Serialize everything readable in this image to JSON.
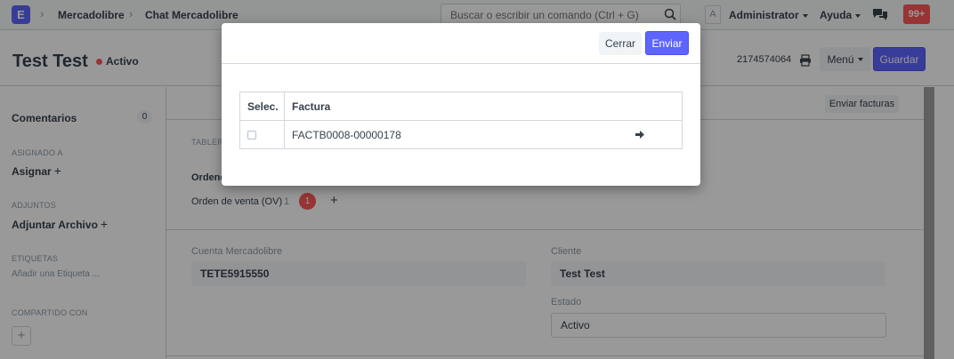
{
  "navbar": {
    "app_initial": "E",
    "breadcrumbs": [
      "Mercadolibre",
      "Chat Mercadolibre"
    ],
    "search_placeholder": "Buscar o escribir un comando (Ctrl + G)",
    "user_initial": "A",
    "user_menu": "Administrator",
    "help_menu": "Ayuda",
    "notification_count": "99+",
    "accent_color": "#5e64ff",
    "badge_color": "#ff5858"
  },
  "page_head": {
    "title": "Test Test",
    "status": "Activo",
    "doc_id": "2174574064",
    "menu_label": "Menú",
    "save_label": "Guardar"
  },
  "sidebar": {
    "comments_label": "Comentarios",
    "comments_count": "0",
    "assigned_heading": "ASIGNADO A",
    "assign_action": "Asignar",
    "attachments_heading": "ADJUNTOS",
    "attach_action": "Adjuntar Archivo",
    "tags_heading": "ETIQUETAS",
    "add_tag": "Añadir una Etiqueta ...",
    "shared_heading": "COMPARTIDO CON",
    "plus": "+"
  },
  "main": {
    "send_invoices_label": "Enviar facturas",
    "section_title": "TABLER",
    "orders_label": "Ordene",
    "sales_order_label": "Orden de venta (OV)",
    "sales_order_count": "1",
    "sales_order_badge": "1",
    "plus": "+",
    "fields": {
      "account_label": "Cuenta Mercadolibre",
      "account_value": "TETE5915550",
      "customer_label": "Cliente",
      "customer_value": "Test Test",
      "state_label": "Estado",
      "state_value": "Activo"
    }
  },
  "modal": {
    "close_label": "Cerrar",
    "send_label": "Enviar",
    "table_headers": [
      "Selec.",
      "Factura"
    ],
    "rows": [
      {
        "invoice": "FACTB0008-00000178"
      }
    ]
  }
}
